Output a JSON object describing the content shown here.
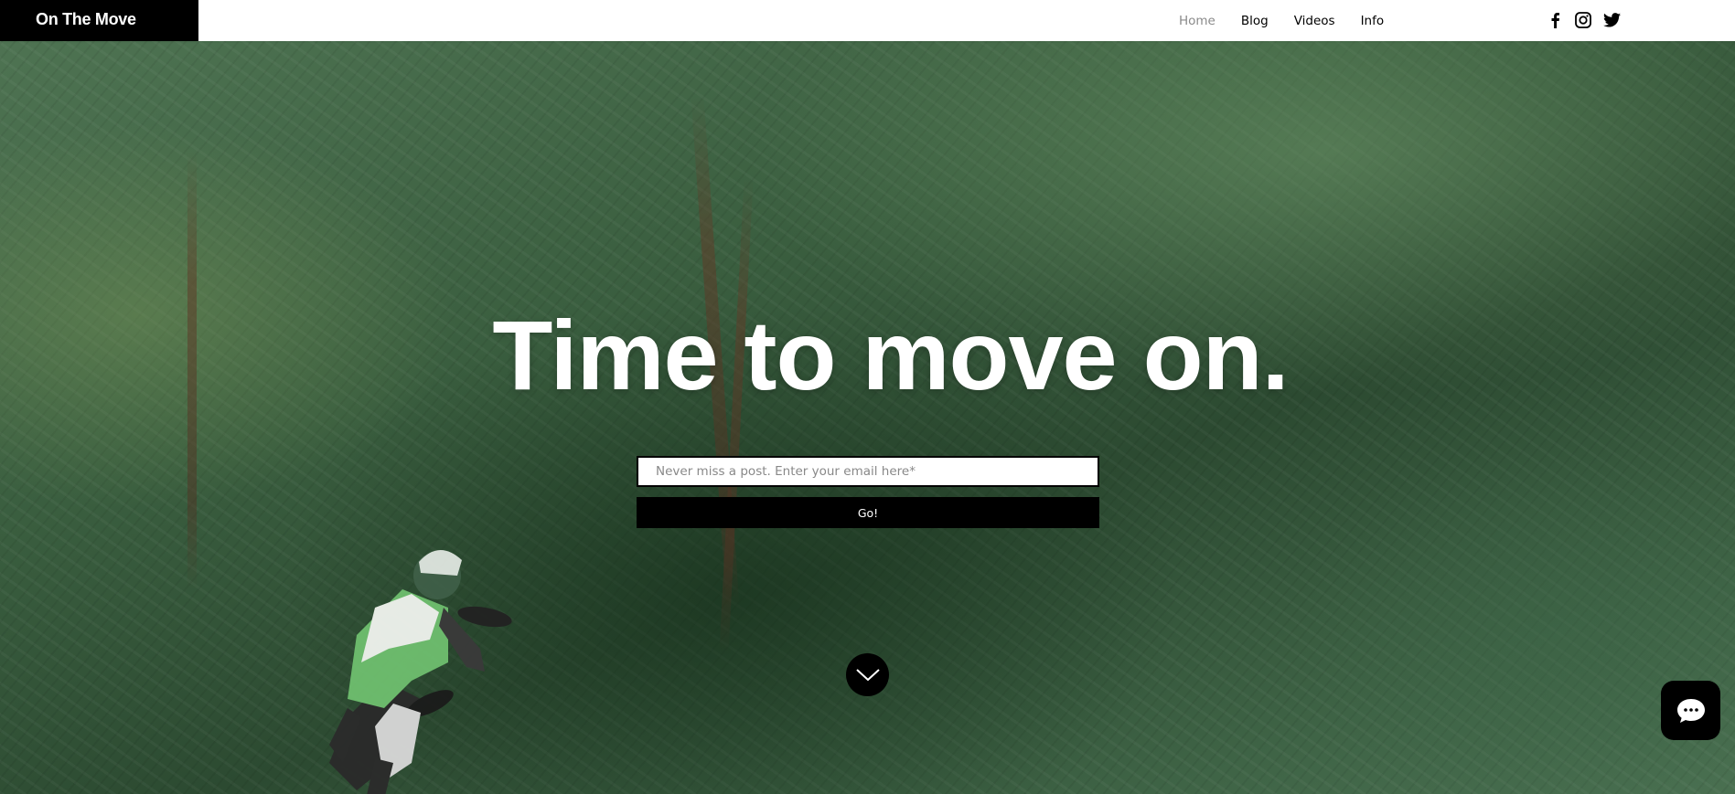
{
  "site": {
    "logo_text": "On The Move"
  },
  "nav": {
    "items": [
      {
        "label": "Home",
        "active": true
      },
      {
        "label": "Blog",
        "active": false
      },
      {
        "label": "Videos",
        "active": false
      },
      {
        "label": "Info",
        "active": false
      }
    ]
  },
  "social": {
    "icons": [
      "facebook-icon",
      "instagram-icon",
      "twitter-icon"
    ]
  },
  "hero": {
    "title": "Time to move on.",
    "email_placeholder": "Never miss a post. Enter your email here*",
    "email_value": "",
    "submit_label": "Go!"
  },
  "colors": {
    "header_bg": "#ffffff",
    "logo_bg": "#000000",
    "nav_active": "#8a8a8a",
    "button_bg": "#000000",
    "hero_text": "#ffffff"
  }
}
